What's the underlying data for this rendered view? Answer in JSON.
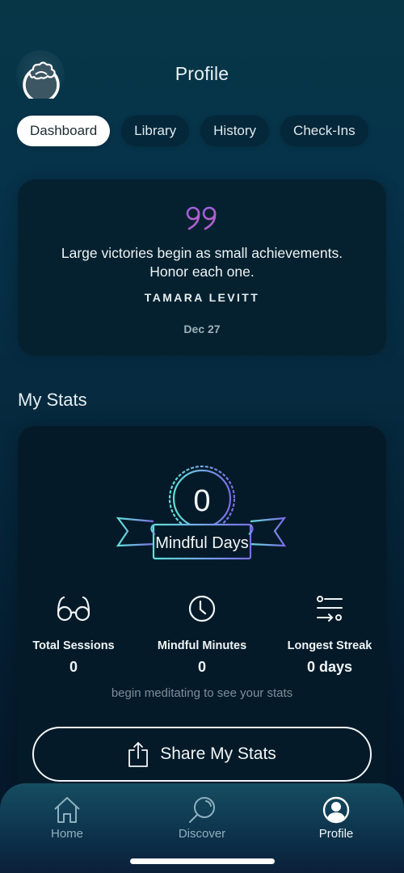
{
  "header": {
    "title": "Profile",
    "avatar_icon": "cloud-avatar-icon"
  },
  "tabs": [
    {
      "label": "Dashboard",
      "active": true
    },
    {
      "label": "Library",
      "active": false
    },
    {
      "label": "History",
      "active": false
    },
    {
      "label": "Check-Ins",
      "active": false
    }
  ],
  "quote": {
    "icon": "quote-mark-icon",
    "line1": "Large victories begin as small achievements.",
    "line2": "Honor each one.",
    "author": "TAMARA LEVITT",
    "date": "Dec 27",
    "accent_color": "#a45fd6"
  },
  "stats": {
    "section_title": "My Stats",
    "badge": {
      "count": "0",
      "label": "Mindful Days"
    },
    "items": [
      {
        "icon": "glasses-icon",
        "label": "Total Sessions",
        "value": "0"
      },
      {
        "icon": "clock-icon",
        "label": "Mindful Minutes",
        "value": "0"
      },
      {
        "icon": "streak-list-icon",
        "label": "Longest Streak",
        "value": "0 days"
      }
    ],
    "hint": "begin meditating to see your stats",
    "share_label": "Share My Stats"
  },
  "nav": {
    "items": [
      {
        "icon": "home-icon",
        "label": "Home",
        "active": false
      },
      {
        "icon": "discover-icon",
        "label": "Discover",
        "active": false
      },
      {
        "icon": "profile-icon",
        "label": "Profile",
        "active": true
      }
    ]
  }
}
